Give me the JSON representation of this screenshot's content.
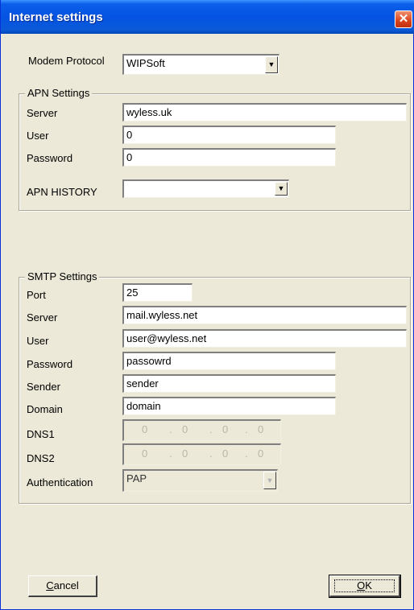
{
  "window": {
    "title": "Internet settings"
  },
  "modem": {
    "label": "Modem Protocol",
    "value": "WIPSoft"
  },
  "apn": {
    "group_title": "APN Settings",
    "server": {
      "label": "Server",
      "value": "wyless.uk"
    },
    "user": {
      "label": "User",
      "value": "0"
    },
    "password": {
      "label": "Password",
      "value": "0"
    },
    "history": {
      "label": "APN HISTORY",
      "value": ""
    }
  },
  "smtp": {
    "group_title": "SMTP Settings",
    "port": {
      "label": "Port",
      "value": "25"
    },
    "server": {
      "label": "Server",
      "value": "mail.wyless.net"
    },
    "user": {
      "label": "User",
      "value": "user@wyless.net"
    },
    "password": {
      "label": "Password",
      "value": "passowrd"
    },
    "sender": {
      "label": "Sender",
      "value": "sender"
    },
    "domain": {
      "label": "Domain",
      "value": "domain"
    },
    "dns1": {
      "label": "DNS1",
      "octets": [
        "0",
        "0",
        "0",
        "0"
      ]
    },
    "dns2": {
      "label": "DNS2",
      "octets": [
        "0",
        "0",
        "0",
        "0"
      ]
    },
    "auth": {
      "label": "Authentication",
      "value": "PAP"
    }
  },
  "buttons": {
    "cancel_prefix": "C",
    "cancel_rest": "ancel",
    "ok_prefix": "O",
    "ok_rest": "K"
  },
  "icons": {
    "close": "close-icon",
    "dropdown": "chevron-down-icon"
  },
  "colors": {
    "titlebar": "#0553e3",
    "dialog_bg": "#ece9d8",
    "close": "#d9431b"
  }
}
